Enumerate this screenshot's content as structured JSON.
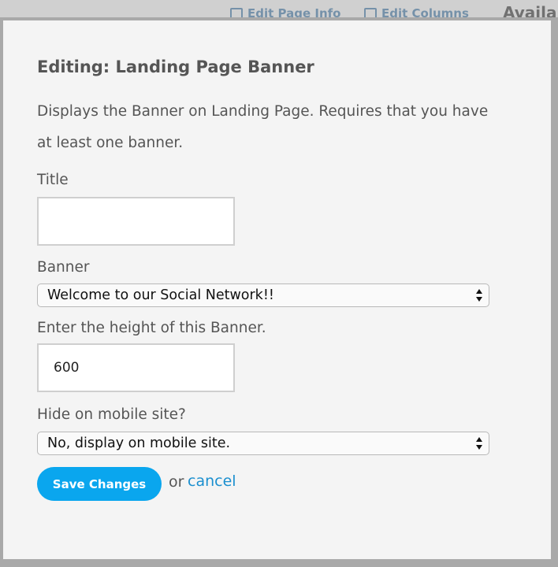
{
  "background": {
    "links": [
      "Edit Page Info",
      "Edit Columns"
    ],
    "heading": "Availab"
  },
  "modal": {
    "title": "Editing: Landing Page Banner",
    "description": "Displays the Banner on Landing Page. Requires that you have at least one banner.",
    "fields": {
      "title": {
        "label": "Title",
        "value": ""
      },
      "banner": {
        "label": "Banner",
        "selected": "Welcome to our Social Network!!"
      },
      "height": {
        "label": "Enter the height of this Banner.",
        "value": "600"
      },
      "mobile": {
        "label": "Hide on mobile site?",
        "selected": "No, display on mobile site."
      }
    },
    "actions": {
      "save_label": "Save Changes",
      "or_text": "or",
      "cancel_label": "cancel"
    }
  },
  "colors": {
    "accent": "#0aa6ee",
    "link": "#1b8fcf",
    "text": "#555555",
    "overlay": "#a9a9a9"
  }
}
